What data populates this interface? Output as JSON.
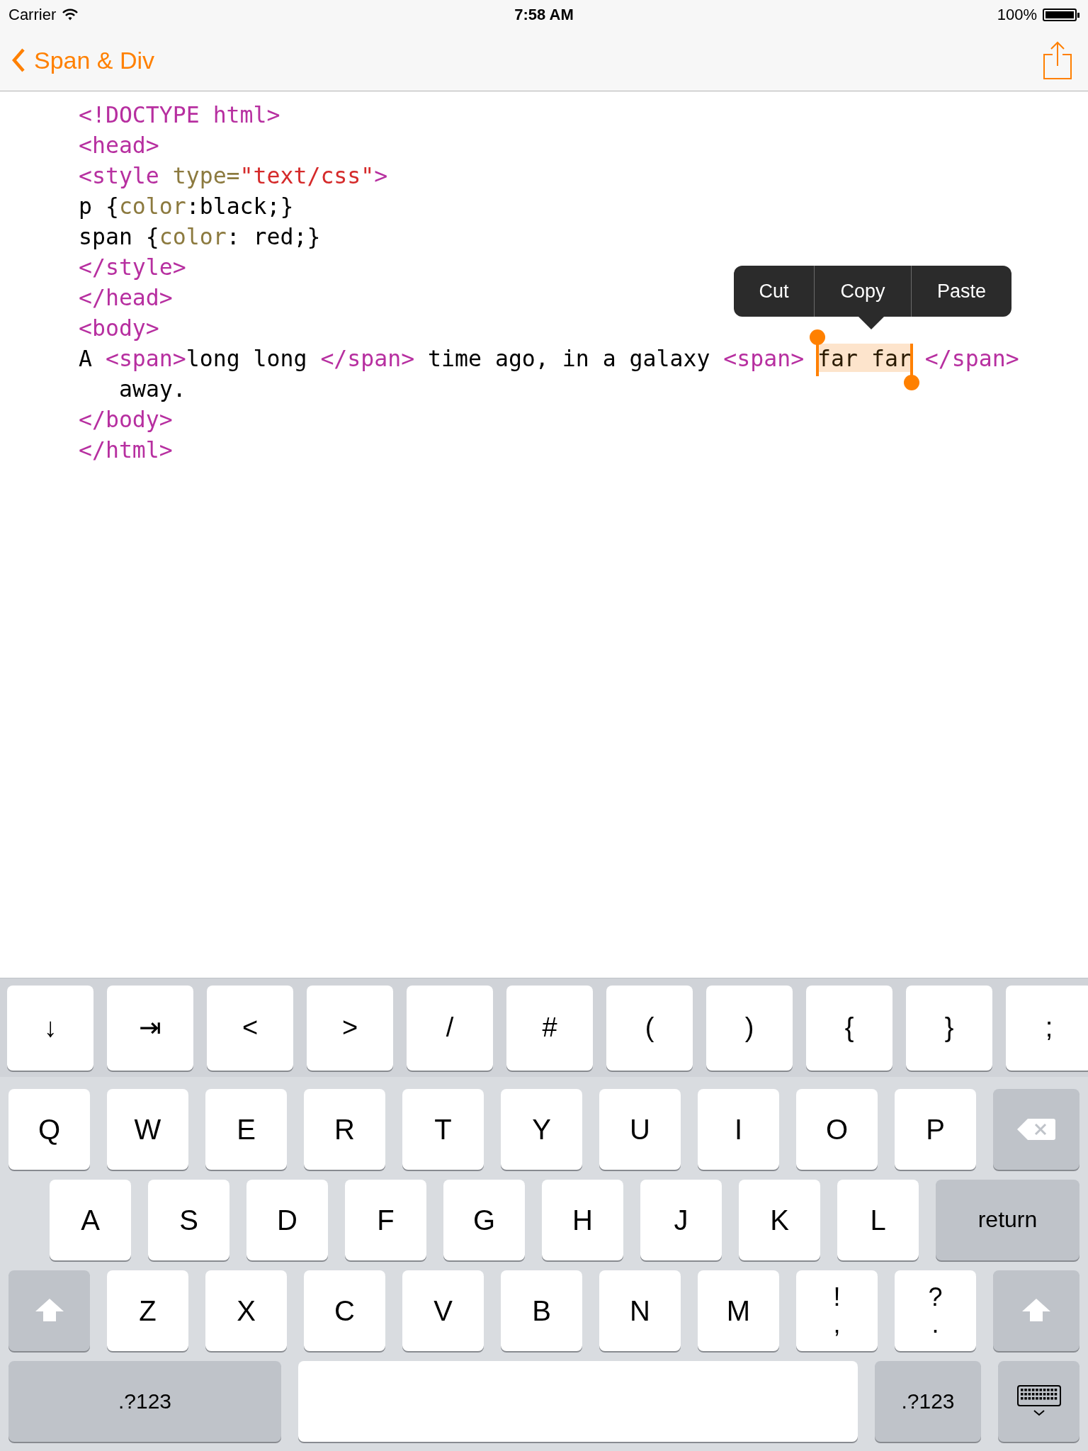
{
  "status_bar": {
    "carrier": "Carrier",
    "time": "7:58 AM",
    "battery": "100%"
  },
  "nav": {
    "back_label": "Span & Div"
  },
  "editor": {
    "lines": [
      {
        "wrapped": false,
        "tokens": [
          {
            "kind": "tag",
            "text": "<!DOCTYPE html>"
          }
        ]
      },
      {
        "wrapped": false,
        "tokens": [
          {
            "kind": "tag",
            "text": "<head>"
          }
        ]
      },
      {
        "wrapped": false,
        "tokens": [
          {
            "kind": "tag",
            "text": "<style "
          },
          {
            "kind": "attr",
            "text": "type="
          },
          {
            "kind": "string",
            "text": "\"text/css\""
          },
          {
            "kind": "tag",
            "text": ">"
          }
        ]
      },
      {
        "wrapped": false,
        "tokens": [
          {
            "kind": "plain",
            "text": "p {"
          },
          {
            "kind": "attr",
            "text": "color"
          },
          {
            "kind": "plain",
            "text": ":black;}"
          }
        ]
      },
      {
        "wrapped": false,
        "tokens": [
          {
            "kind": "plain",
            "text": "span {"
          },
          {
            "kind": "attr",
            "text": "color"
          },
          {
            "kind": "plain",
            "text": ": red;}"
          }
        ]
      },
      {
        "wrapped": false,
        "tokens": [
          {
            "kind": "tag",
            "text": "</style>"
          }
        ]
      },
      {
        "wrapped": false,
        "tokens": [
          {
            "kind": "tag",
            "text": "</head>"
          }
        ]
      },
      {
        "wrapped": false,
        "tokens": [
          {
            "kind": "tag",
            "text": "<body>"
          }
        ]
      },
      {
        "wrapped": false,
        "tokens": [
          {
            "kind": "plain",
            "text": "A "
          },
          {
            "kind": "tag",
            "text": "<span>"
          },
          {
            "kind": "plain",
            "text": "long long "
          },
          {
            "kind": "tag",
            "text": "</span>"
          },
          {
            "kind": "plain",
            "text": " time ago, in a galaxy "
          },
          {
            "kind": "tag",
            "text": "<span> "
          },
          {
            "kind": "selection",
            "text": "far far"
          },
          {
            "kind": "tag",
            "text": " </span>"
          }
        ]
      },
      {
        "wrapped": true,
        "tokens": [
          {
            "kind": "plain",
            "text": "away."
          }
        ]
      },
      {
        "wrapped": false,
        "tokens": [
          {
            "kind": "tag",
            "text": "</body>"
          }
        ]
      },
      {
        "wrapped": false,
        "tokens": [
          {
            "kind": "tag",
            "text": "</html>"
          }
        ]
      }
    ]
  },
  "edit_menu": {
    "items": [
      "Cut",
      "Copy",
      "Paste"
    ]
  },
  "keyboard": {
    "accessory_keys": [
      "↓",
      "⇥",
      "<",
      ">",
      "/",
      "#",
      "(",
      ")",
      "{",
      "}",
      ";"
    ],
    "rows": [
      {
        "keys": [
          {
            "kind": "char",
            "label": "Q"
          },
          {
            "kind": "char",
            "label": "W"
          },
          {
            "kind": "char",
            "label": "E"
          },
          {
            "kind": "char",
            "label": "R"
          },
          {
            "kind": "char",
            "label": "T"
          },
          {
            "kind": "char",
            "label": "Y"
          },
          {
            "kind": "char",
            "label": "U"
          },
          {
            "kind": "char",
            "label": "I"
          },
          {
            "kind": "char",
            "label": "O"
          },
          {
            "kind": "char",
            "label": "P"
          },
          {
            "kind": "delete"
          }
        ]
      },
      {
        "keys": [
          {
            "kind": "char",
            "label": "A"
          },
          {
            "kind": "char",
            "label": "S"
          },
          {
            "kind": "char",
            "label": "D"
          },
          {
            "kind": "char",
            "label": "F"
          },
          {
            "kind": "char",
            "label": "G"
          },
          {
            "kind": "char",
            "label": "H"
          },
          {
            "kind": "char",
            "label": "J"
          },
          {
            "kind": "char",
            "label": "K"
          },
          {
            "kind": "char",
            "label": "L"
          },
          {
            "kind": "return",
            "label": "return"
          }
        ]
      },
      {
        "keys": [
          {
            "kind": "shift"
          },
          {
            "kind": "char",
            "label": "Z"
          },
          {
            "kind": "char",
            "label": "X"
          },
          {
            "kind": "char",
            "label": "C"
          },
          {
            "kind": "char",
            "label": "V"
          },
          {
            "kind": "char",
            "label": "B"
          },
          {
            "kind": "char",
            "label": "N"
          },
          {
            "kind": "char",
            "label": "M"
          },
          {
            "kind": "dual",
            "top": "!",
            "bottom": ","
          },
          {
            "kind": "dual",
            "top": "?",
            "bottom": "."
          },
          {
            "kind": "shift"
          }
        ]
      },
      {
        "keys": [
          {
            "kind": "mode",
            "label": ".?123"
          },
          {
            "kind": "space"
          },
          {
            "kind": "mode_small",
            "label": ".?123"
          },
          {
            "kind": "dismiss"
          }
        ]
      }
    ]
  }
}
